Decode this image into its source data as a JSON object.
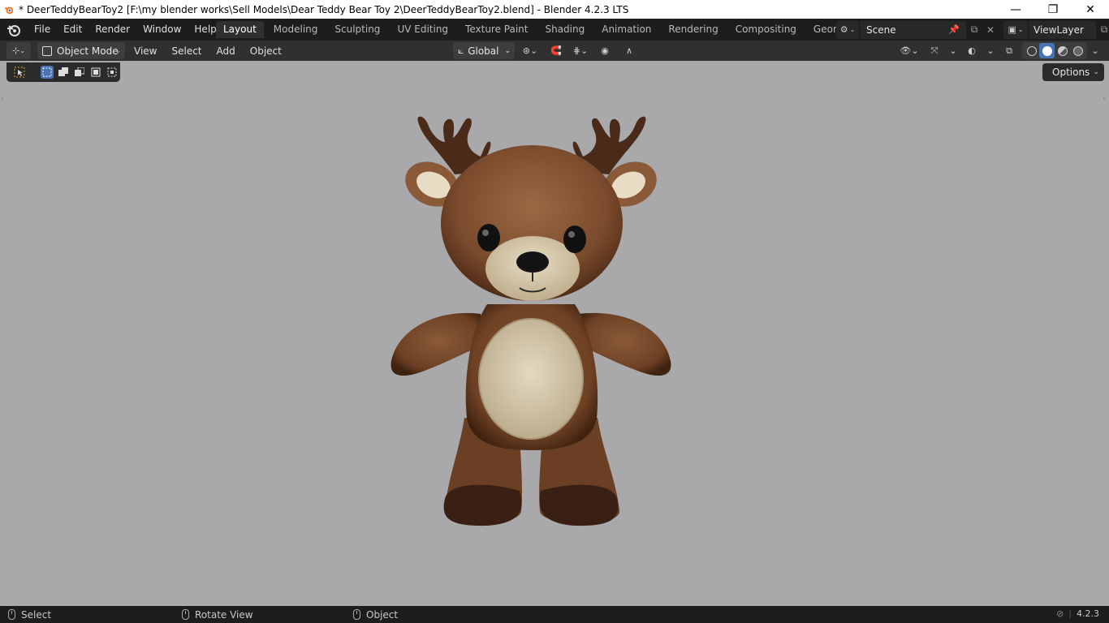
{
  "window": {
    "title": "* DeerTeddyBearToy2 [F:\\my blender works\\Sell Models\\Dear Teddy Bear Toy 2\\DeerTeddyBearToy2.blend] - Blender 4.2.3 LTS",
    "controls": {
      "minimize": "—",
      "restore": "❐",
      "close": "✕"
    }
  },
  "menubar": {
    "items": [
      "File",
      "Edit",
      "Render",
      "Window",
      "Help"
    ]
  },
  "workspaces": {
    "tabs": [
      "Layout",
      "Modeling",
      "Sculpting",
      "UV Editing",
      "Texture Paint",
      "Shading",
      "Animation",
      "Rendering",
      "Compositing",
      "Geometry Nodes"
    ],
    "active": "Layout"
  },
  "scene": {
    "name": "Scene"
  },
  "view_layer": {
    "name": "ViewLayer"
  },
  "viewport_header": {
    "mode": "Object Mode",
    "menus": [
      "View",
      "Select",
      "Add",
      "Object"
    ],
    "transform_orientation": "Global"
  },
  "tool_settings": {
    "options_label": "Options"
  },
  "statusbar": {
    "left_action": "Select",
    "middle_action": "Rotate View",
    "right_action": "Object",
    "version": "4.2.3"
  },
  "colors": {
    "viewport_bg": "#a9a9ab",
    "header_bg": "#303030",
    "topbar_bg": "#1d1d1d",
    "accent": "#4772b3",
    "fur": "#7a4a2c",
    "belly": "#d9cdb2"
  }
}
